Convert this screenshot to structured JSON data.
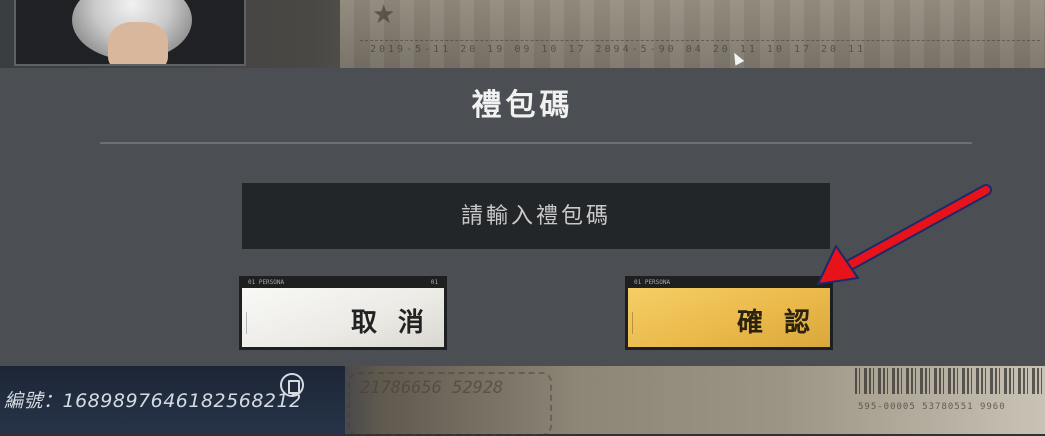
{
  "background": {
    "serial_label": "編號：16898976461825682​12",
    "stamp_text": "21786656 52928",
    "paper_digits": "2019-5-11  20  19  09  10  17  2094-5-90  04  20  11  10  17  20  11",
    "barcode_digits": "595-00005 53780551 9960"
  },
  "dialog": {
    "title": "禮包碼",
    "input": {
      "placeholder": "請輸入禮包碼",
      "value": ""
    },
    "cancel_button": {
      "label": "取 消",
      "tag": "01 PERSONA",
      "tag_right": "01"
    },
    "confirm_button": {
      "label": "確 認",
      "tag": "01 PERSONA",
      "tag_right": ""
    }
  },
  "annotation": {
    "arrow_color": "#e8121a",
    "arrow_outline": "#1b2a6b"
  },
  "colors": {
    "dialog_bg": "#4b4f53",
    "input_bg": "#232629",
    "confirm_accent": "#eab94a",
    "cancel_bg": "#f4f3ef"
  }
}
